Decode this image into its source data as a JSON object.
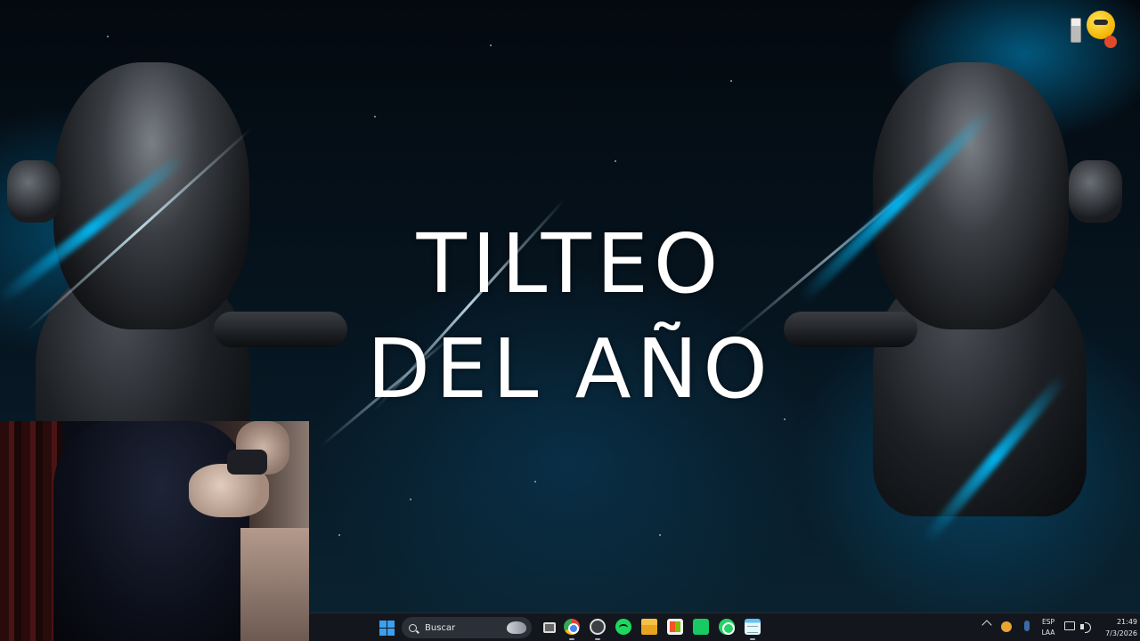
{
  "wallpaper": {
    "title_line1": "TILTEO",
    "title_line2": "DEL AÑO"
  },
  "taskbar": {
    "search_label": "Buscar",
    "apps": [
      {
        "name": "start",
        "icon": "windows-icon"
      },
      {
        "name": "search",
        "icon": "search-icon"
      },
      {
        "name": "task-view",
        "icon": "task-view-icon"
      },
      {
        "name": "chrome",
        "icon": "chrome-icon"
      },
      {
        "name": "obs",
        "icon": "obs-icon"
      },
      {
        "name": "spotify",
        "icon": "spotify-icon"
      },
      {
        "name": "file-explorer",
        "icon": "folder-icon"
      },
      {
        "name": "microsoft-store",
        "icon": "store-icon"
      },
      {
        "name": "green-app",
        "icon": "green-app-icon"
      },
      {
        "name": "whatsapp",
        "icon": "whatsapp-icon"
      },
      {
        "name": "notepad",
        "icon": "notepad-icon"
      }
    ]
  },
  "tray": {
    "lang_line1": "ESP",
    "lang_line2": "LAA",
    "time": "21:49",
    "date": "7/3/2026"
  },
  "colors": {
    "accent": "#3aa0f0",
    "background": "#061520",
    "taskbar": "#14181e"
  }
}
